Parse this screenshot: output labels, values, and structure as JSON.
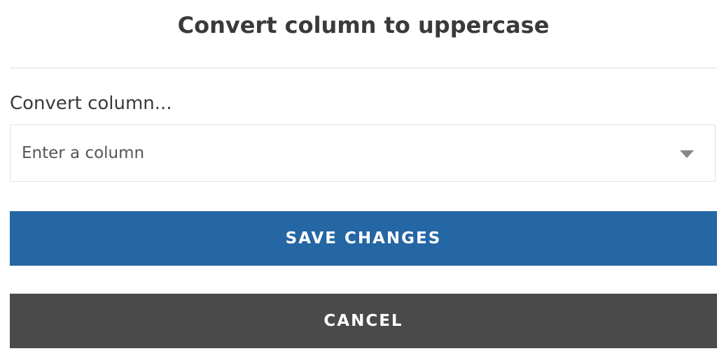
{
  "dialog": {
    "title": "Convert column to uppercase"
  },
  "form": {
    "column_label": "Convert column...",
    "column_select": {
      "placeholder": "Enter a column",
      "icon": "chevron-down-icon"
    }
  },
  "actions": {
    "save_label": "SAVE CHANGES",
    "cancel_label": "CANCEL"
  },
  "colors": {
    "save_button": "#2566a4",
    "cancel_button": "#4a4a4a",
    "text": "#3a3a3a"
  }
}
